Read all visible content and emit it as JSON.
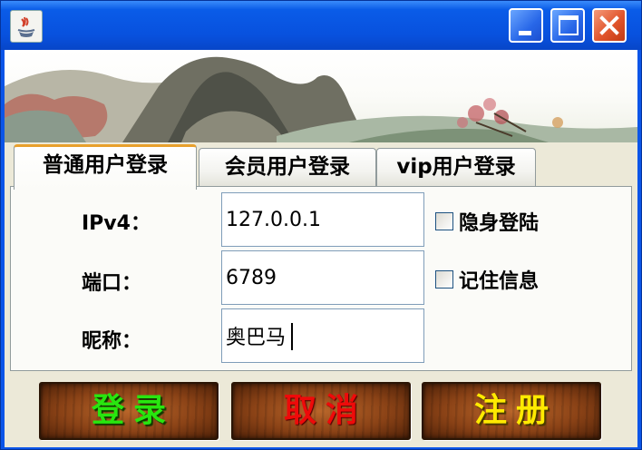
{
  "window": {
    "minimize_icon": "minimize-icon",
    "maximize_icon": "maximize-icon",
    "close_icon": "close-icon",
    "app_icon": "java-coffee-icon"
  },
  "tabs": [
    {
      "label": "普通用户登录",
      "active": true
    },
    {
      "label": "会员用户登录",
      "active": false
    },
    {
      "label": "vip用户登录",
      "active": false
    }
  ],
  "form": {
    "ip_label": "IPv4：",
    "ip_value": "127.0.0.1",
    "port_label": "端口：",
    "port_value": "6789",
    "nick_label": "昵称：",
    "nick_value": "奥巴马"
  },
  "options": {
    "invisible_label": "隐身登陆",
    "invisible_checked": false,
    "remember_label": "记住信息",
    "remember_checked": false
  },
  "buttons": {
    "login": "登录",
    "cancel": "取消",
    "register": "注册"
  },
  "colors": {
    "titlebar": "#0b55e8",
    "login_text": "#28e60f",
    "cancel_text": "#ee0a0a",
    "register_text": "#ffea00"
  }
}
